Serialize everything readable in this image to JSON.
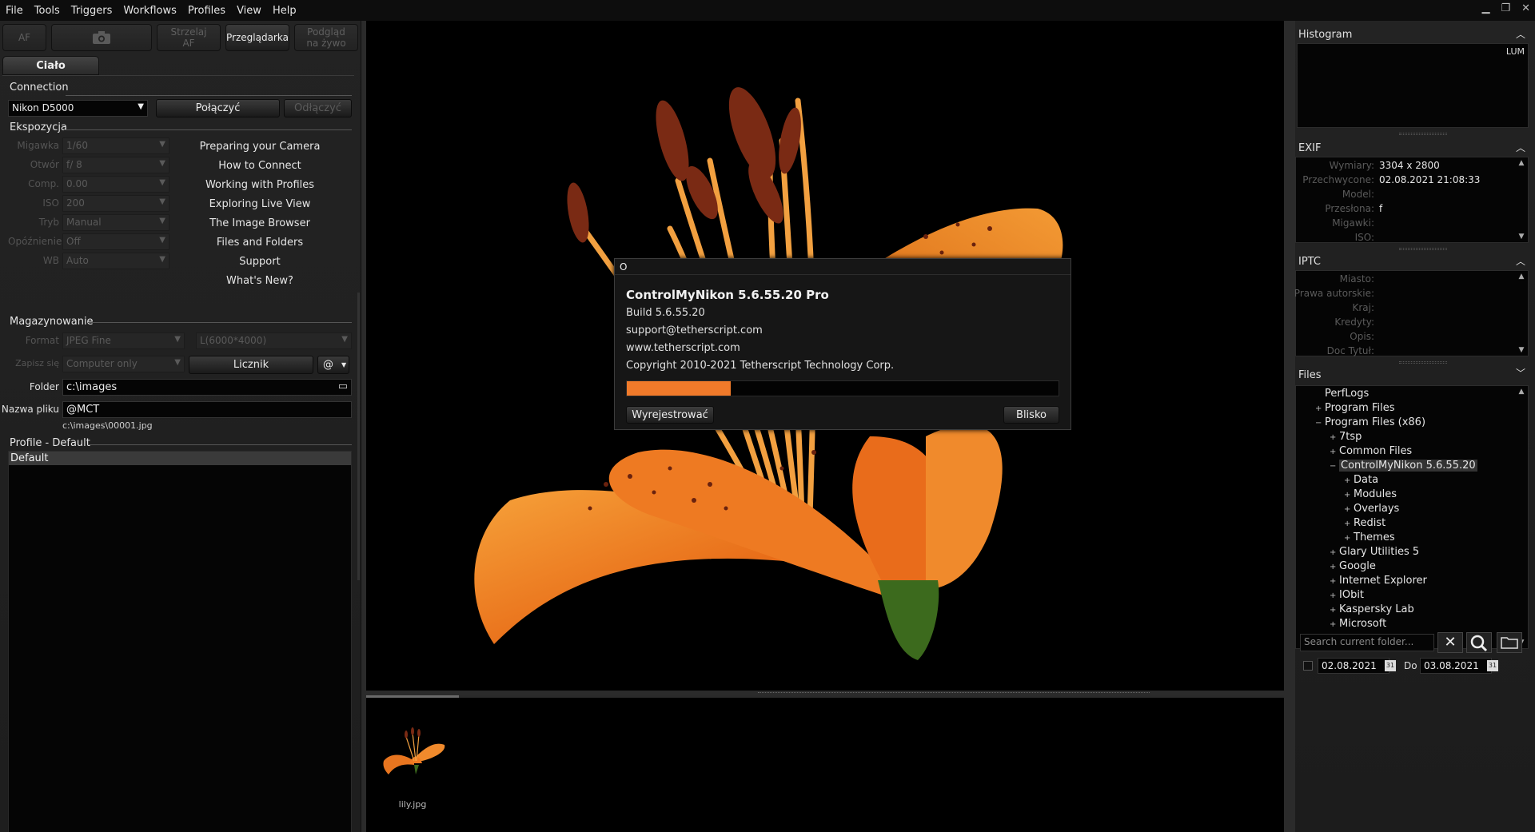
{
  "menubar": {
    "items": [
      "File",
      "Tools",
      "Triggers",
      "Workflows",
      "Profiles",
      "View",
      "Help"
    ]
  },
  "toolbar": {
    "af": "AF",
    "shoot_af": "Strzelaj\nAF",
    "browser": "Przeglądarka",
    "liveview": "Podgląd\nna żywo"
  },
  "tab": {
    "body": "Ciało"
  },
  "connection": {
    "title": "Connection",
    "camera": "Nikon D5000",
    "connect": "Połączyć",
    "disconnect": "Odłączyć"
  },
  "exposure": {
    "title": "Ekspozycja",
    "rows": [
      {
        "label": "Migawka",
        "value": "1/60"
      },
      {
        "label": "Otwór",
        "value": "f/ 8"
      },
      {
        "label": "Comp.",
        "value": "0.00"
      },
      {
        "label": "ISO",
        "value": "200"
      },
      {
        "label": "Tryb",
        "value": "Manual"
      },
      {
        "label": "Opóźnienie",
        "value": "Off"
      },
      {
        "label": "WB",
        "value": "Auto"
      }
    ]
  },
  "help_links": [
    "Preparing your Camera",
    "How to Connect",
    "Working with Profiles",
    "Exploring Live View",
    "The Image Browser",
    "Files and Folders",
    "Support",
    "What's New?"
  ],
  "storage": {
    "title": "Magazynowanie",
    "format_label": "Format",
    "format_value": "JPEG Fine",
    "size_value": "L(6000*4000)",
    "save_label": "Zapisz się",
    "save_value": "Computer only",
    "counter": "Licznik",
    "at": "@",
    "folder_label": "Folder",
    "folder_value": "c:\\images",
    "filename_label": "Nazwa pliku",
    "filename_value": "@MCT",
    "path_preview": "c:\\images\\00001.jpg"
  },
  "profile": {
    "title": "Profile - Default",
    "items": [
      "Default"
    ]
  },
  "about": {
    "title_char": "O",
    "product": "ControlMyNikon 5.6.55.20 Pro",
    "build": "Build 5.6.55.20",
    "email": "support@tetherscript.com",
    "web": "www.tetherscript.com",
    "copyright": "Copyright 2010-2021 Tetherscript Technology Corp.",
    "progress": 0.24,
    "register": "Wyrejestrować",
    "close": "Blisko"
  },
  "filmstrip": {
    "caption": "lily.jpg"
  },
  "histogram": {
    "title": "Histogram",
    "mode": "LUM"
  },
  "exif": {
    "title": "EXIF",
    "rows": [
      {
        "k": "Wymiary:",
        "v": "3304 x 2800"
      },
      {
        "k": "Przechwycone:",
        "v": "02.08.2021 21:08:33"
      },
      {
        "k": "Model:",
        "v": ""
      },
      {
        "k": "Przesłona:",
        "v": "f"
      },
      {
        "k": "Migawki:",
        "v": ""
      },
      {
        "k": "ISO:",
        "v": ""
      }
    ]
  },
  "iptc": {
    "title": "IPTC",
    "rows": [
      {
        "k": "Miasto:",
        "v": ""
      },
      {
        "k": "Prawa autorskie:",
        "v": ""
      },
      {
        "k": "Kraj:",
        "v": ""
      },
      {
        "k": "Kredyty:",
        "v": ""
      },
      {
        "k": "Opis:",
        "v": ""
      },
      {
        "k": "Doc Tytuł:",
        "v": ""
      }
    ]
  },
  "files": {
    "title": "Files",
    "tree": [
      {
        "label": "PerfLogs",
        "depth": 1,
        "exp": ""
      },
      {
        "label": "Program Files",
        "depth": 1,
        "exp": "+"
      },
      {
        "label": "Program Files (x86)",
        "depth": 1,
        "exp": "−"
      },
      {
        "label": "7tsp",
        "depth": 2,
        "exp": "+"
      },
      {
        "label": "Common Files",
        "depth": 2,
        "exp": "+"
      },
      {
        "label": "ControlMyNikon 5.6.55.20",
        "depth": 2,
        "exp": "−",
        "selected": true
      },
      {
        "label": "Data",
        "depth": 3,
        "exp": "+"
      },
      {
        "label": "Modules",
        "depth": 3,
        "exp": "+"
      },
      {
        "label": "Overlays",
        "depth": 3,
        "exp": "+"
      },
      {
        "label": "Redist",
        "depth": 3,
        "exp": "+"
      },
      {
        "label": "Themes",
        "depth": 3,
        "exp": "+"
      },
      {
        "label": "Glary Utilities 5",
        "depth": 2,
        "exp": "+"
      },
      {
        "label": "Google",
        "depth": 2,
        "exp": "+"
      },
      {
        "label": "Internet Explorer",
        "depth": 2,
        "exp": "+"
      },
      {
        "label": "IObit",
        "depth": 2,
        "exp": "+"
      },
      {
        "label": "Kaspersky Lab",
        "depth": 2,
        "exp": "+"
      },
      {
        "label": "Microsoft",
        "depth": 2,
        "exp": "+"
      }
    ],
    "search_placeholder": "Search current folder...",
    "date_from": "02.08.2021",
    "date_to_label": "Do",
    "date_to": "03.08.2021",
    "calendar_day": "31"
  },
  "colors": {
    "accent": "#f07a2a",
    "background": "#1b1b1b",
    "lily": "#f28a2a"
  }
}
